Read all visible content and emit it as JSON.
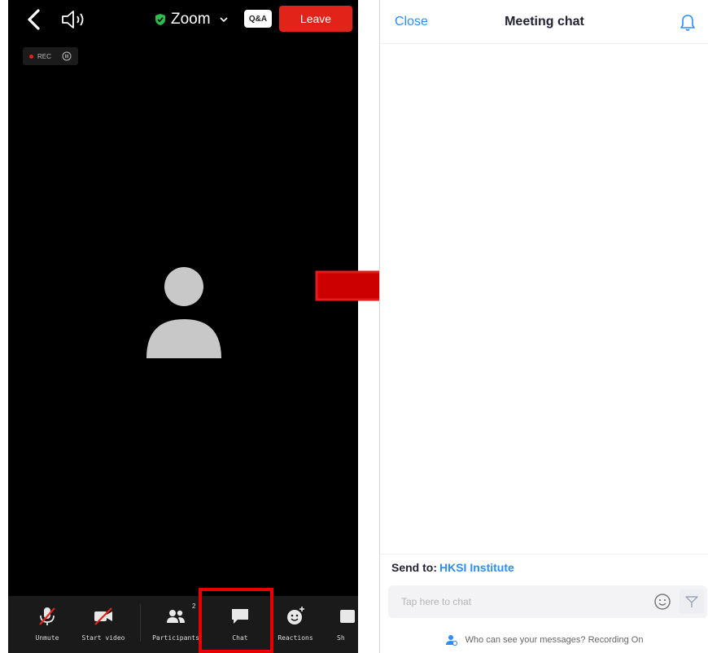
{
  "zoom": {
    "title": "Zoom",
    "qa_label": "Q&A",
    "leave_label": "Leave",
    "rec_label": "REC",
    "toolbar": [
      {
        "label": "Unmute",
        "icon": "mic-muted-icon"
      },
      {
        "label": "Start video",
        "icon": "video-off-icon"
      },
      {
        "label": "Participants",
        "icon": "participants-icon",
        "count": "2"
      },
      {
        "label": "Chat",
        "icon": "chat-icon"
      },
      {
        "label": "Reactions",
        "icon": "reactions-icon"
      },
      {
        "label": "Sh",
        "icon": "share-icon"
      }
    ],
    "colors": {
      "leave": "#e2231a",
      "shield": "#2dbd4e",
      "highlight": "#e80000"
    }
  },
  "arrow": {
    "color": "#cc0000"
  },
  "chat": {
    "close_label": "Close",
    "title": "Meeting chat",
    "send_to_label": "Send to:",
    "send_to_target": "HKSI Institute",
    "input_placeholder": "Tap here to chat",
    "who_can_see": "Who can see your messages? Recording On",
    "colors": {
      "accent": "#2d8cff"
    }
  }
}
